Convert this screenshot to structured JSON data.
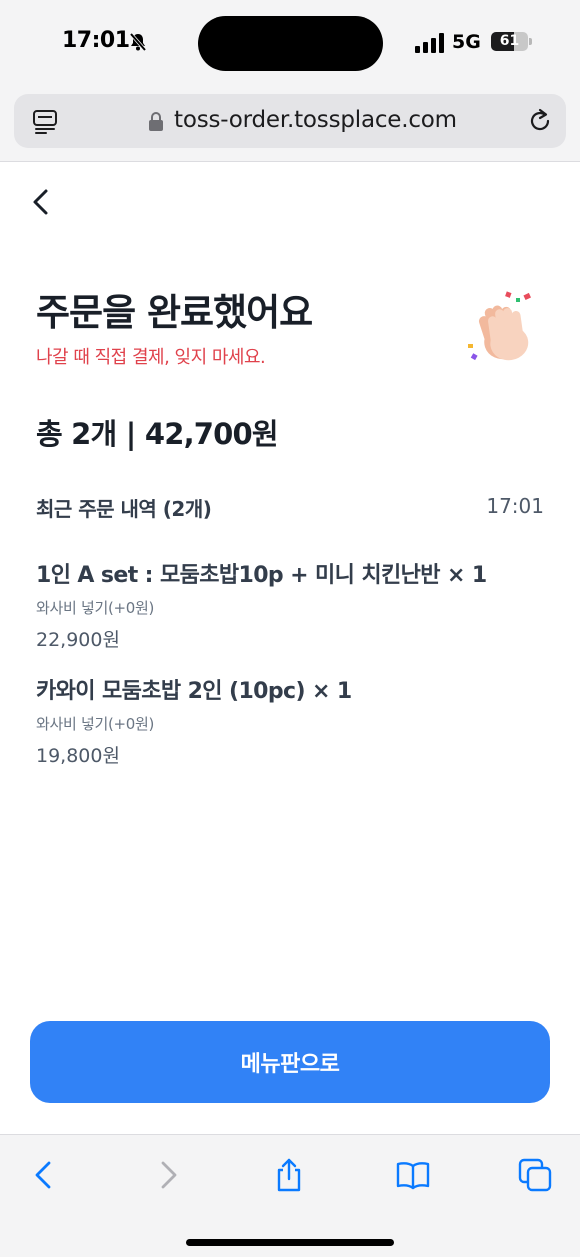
{
  "status_bar": {
    "time": "17:01",
    "network": "5G",
    "battery": "61",
    "battery_level": 0.61
  },
  "browser": {
    "url": "toss-order.tossplace.com"
  },
  "order": {
    "title": "주문을 완료했어요",
    "subtitle": "나갈 때 직접 결제, 잊지 마세요.",
    "total": "총 2개 | 42,700원",
    "recent_label": "최근 주문 내역 (2개)",
    "recent_time": "17:01",
    "items": [
      {
        "name": "1인 A set : 모둠초밥10p + 미니 치킨난반 × 1",
        "option": "와사비 넣기(+0원)",
        "price": "22,900원"
      },
      {
        "name": "카와이 모둠초밥 2인 (10pc) × 1",
        "option": "와사비 넣기(+0원)",
        "price": "19,800원"
      }
    ]
  },
  "actions": {
    "menu_button": "메뉴판으로"
  },
  "colors": {
    "primary": "#3182f6",
    "warning": "#e0424c",
    "text": "#191f28",
    "ios_blue": "#0a7aff"
  },
  "icons": {
    "mute": "bell-slash-icon",
    "signal": "cellular-signal-icon",
    "reader": "reader-mode-icon",
    "lock": "lock-icon",
    "reload": "reload-icon",
    "back": "chevron-left-icon",
    "celebrate": "clapping-hands-icon",
    "nav_back": "browser-back-icon",
    "nav_forward": "browser-forward-icon",
    "share": "share-icon",
    "bookmarks": "bookmarks-icon",
    "tabs": "tabs-icon"
  }
}
